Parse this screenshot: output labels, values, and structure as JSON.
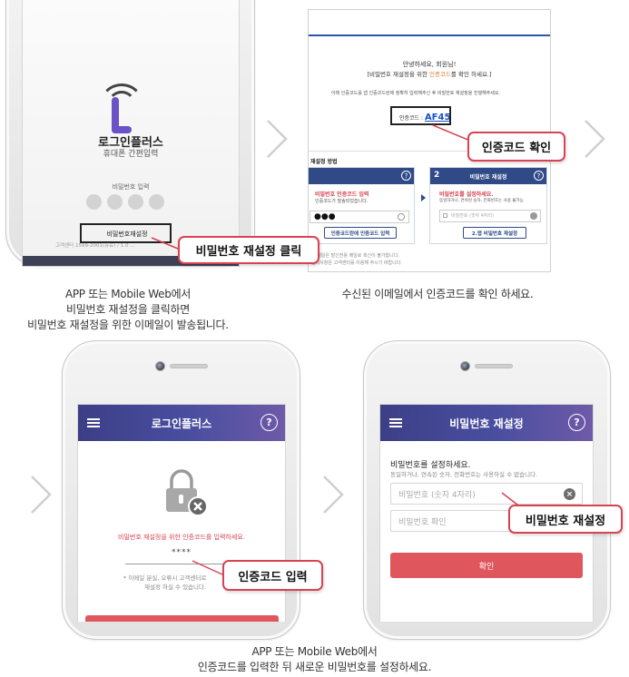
{
  "step1": {
    "brand_title": "로그인플러스",
    "brand_subtitle": "휴대폰 간편입력",
    "pin_label": "비밀번호 입력",
    "reset_link": "비밀번호재설정",
    "footer_text": "고객센터 1599-2001(유료) / 1.0 ...",
    "callout": "비밀번호 재설정 클릭",
    "caption_lines": [
      "APP 또는 Mobile Web에서",
      "비밀번호 재설정을 클릭하면",
      "비밀번호 재설정을 위한 이메일이 발송됩니다."
    ]
  },
  "step2": {
    "greeting": "안녕하세요, 회원님!",
    "message_prefix": "[비밀번호 재설정을 위한 ",
    "message_highlight": "인증코드",
    "message_suffix": "를 확인 하세요.]",
    "instruction": "아래 인증코드를 앱 인증코드란에 정확히 입력해주신 후 비밀번호 재설정을 진행해주세요.",
    "code_label": "인증코드 :",
    "code_value": "AF45",
    "callout": "인증코드 확인",
    "method_title": "재설정 방법",
    "card1_title": "비밀번호 인증코드 입력",
    "card1_desc": "인증코드가 발송되었습니다.",
    "card1_button": "인증코드란에 인증코드 입력",
    "card2_num": "2",
    "card2_title": "비밀번호 재설정",
    "card2_desc1": "비밀번호를 설정하세요.",
    "card2_desc2": "동일하거나, 연속된 숫자, 전화번호는 사용 불가능",
    "card2_input": "비밀번호 (숫자 4자리)",
    "card2_button": "2.앱 비밀번호 재설정",
    "footer1": "본 메일은 발신전용 메일로 회신이 불가합니다.",
    "footer2": "문의사항은 고객센터를 이용해 주시기 바랍니다.",
    "caption_lines": [
      "수신된 이메일에서 인증코드를 확인 하세요."
    ]
  },
  "step3": {
    "appbar_title": "로그인플러스",
    "help": "?",
    "prompt": "비밀번호 재설정을 위한 인증코드를 입력하세요.",
    "masked_code": "****",
    "note1": "* 이메일 분실, 오류시 고객센터로",
    "note2": "재설정 하실 수 있습니다.",
    "callout": "인증코드 입력"
  },
  "step4": {
    "appbar_title": "비밀번호 재설정",
    "help": "?",
    "heading": "비밀번호를 설정하세요.",
    "subtext": "동일하거나, 연속된 숫자, 전화번호는 사용하실 수 없습니다.",
    "pw_placeholder": "비밀번호 (숫자 4자리)",
    "pw_confirm_placeholder": "비밀번호 확인",
    "confirm_button": "확인",
    "callout": "비밀번호 재설정"
  },
  "bottom_caption_lines": [
    "APP 또는 Mobile Web에서",
    "인증코드를 입력한 뒤 새로운 비밀번호를 설정하세요."
  ],
  "colors": {
    "accent_red": "#d84351",
    "brand_purple": "#6b52c6",
    "appbar": "#3c3f86",
    "code_blue": "#1a4fc4",
    "button_red": "#e0565d"
  }
}
